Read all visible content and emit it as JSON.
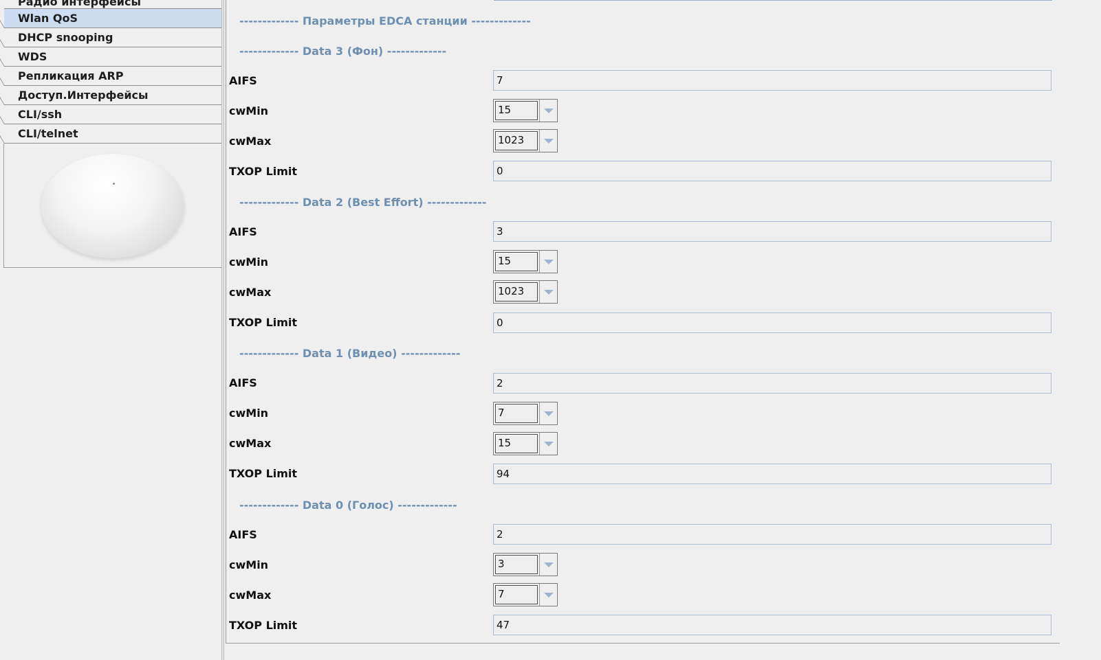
{
  "sidebar": {
    "items": [
      {
        "label": "Радио интерфейсы"
      },
      {
        "label": "Wlan QoS"
      },
      {
        "label": "DHCP snooping"
      },
      {
        "label": "WDS"
      },
      {
        "label": "Репликация ARP"
      },
      {
        "label": "Доступ.Интерфейсы"
      },
      {
        "label": "CLI/ssh"
      },
      {
        "label": "CLI/telnet"
      }
    ],
    "active_item": "Wlan QoS",
    "device_image": "access-point-image"
  },
  "main": {
    "title": "------------- Параметры EDCA станции -------------",
    "sections": [
      {
        "header": "------------- Data 3 (Фон) -------------",
        "aifs": "7",
        "cwmin": "15",
        "cwmax": "1023",
        "txop": "0"
      },
      {
        "header": "------------- Data 2 (Best Effort) -------------",
        "aifs": "3",
        "cwmin": "15",
        "cwmax": "1023",
        "txop": "0"
      },
      {
        "header": "------------- Data 1 (Видео) -------------",
        "aifs": "2",
        "cwmin": "7",
        "cwmax": "15",
        "txop": "94"
      },
      {
        "header": "------------- Data 0 (Голос) -------------",
        "aifs": "2",
        "cwmin": "3",
        "cwmax": "7",
        "txop": "47"
      }
    ],
    "labels": {
      "aifs": "AIFS",
      "cwmin": "cwMin",
      "cwmax": "cwMax",
      "txop": "TXOP Limit"
    }
  },
  "colors": {
    "accent_header": "#6f8fb0",
    "active_nav_bg": "#cddcf0",
    "field_border": "#a9bdd2",
    "background": "#efefef"
  }
}
